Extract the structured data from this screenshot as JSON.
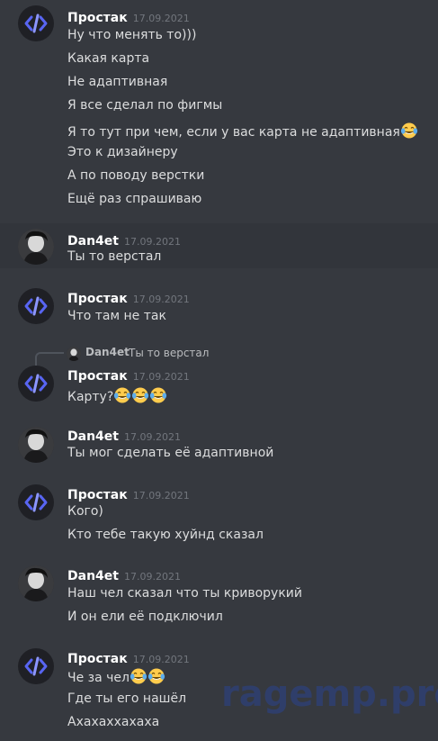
{
  "messages": [
    {
      "author": "Простак",
      "time": "17.09.2021",
      "avatar": "code-logo",
      "lines": [
        "Ну что менять то)))",
        "Какая карта",
        "Не адаптивная",
        "Я все сделал по фигмы",
        "Я то тут при чем, если у вас карта не адаптивная",
        "Это к дизайнеру",
        "А по поводу верстки",
        "Ещё раз спрашиваю"
      ]
    },
    {
      "author": "Dan4et",
      "time": "17.09.2021",
      "avatar": "photo",
      "lines": [
        "Ты то верстал"
      ]
    },
    {
      "author": "Простак",
      "time": "17.09.2021",
      "avatar": "code-logo",
      "lines": [
        "Что там не так"
      ]
    },
    {
      "reply": {
        "author": "Dan4et",
        "text": "Ты то верстал"
      },
      "author": "Простак",
      "time": "17.09.2021",
      "avatar": "code-logo",
      "lines": [
        "Карту?"
      ]
    },
    {
      "author": "Dan4et",
      "time": "17.09.2021",
      "avatar": "photo",
      "lines": [
        "Ты мог сделать её адаптивной"
      ]
    },
    {
      "author": "Простак",
      "time": "17.09.2021",
      "avatar": "code-logo",
      "lines": [
        "Кого)",
        "Кто тебе такую хуйнд сказал"
      ]
    },
    {
      "author": "Dan4et",
      "time": "17.09.2021",
      "avatar": "photo",
      "lines": [
        "Наш чел сказал что ты криворукий",
        "И он ели её подключил"
      ]
    },
    {
      "author": "Простак",
      "time": "17.09.2021",
      "avatar": "code-logo",
      "lines": [
        "Че за чел",
        "Где ты его нашёл",
        "Ахахаххахаха"
      ]
    }
  ],
  "emoji": "joy-icon",
  "watermark": "ragemp.pro"
}
